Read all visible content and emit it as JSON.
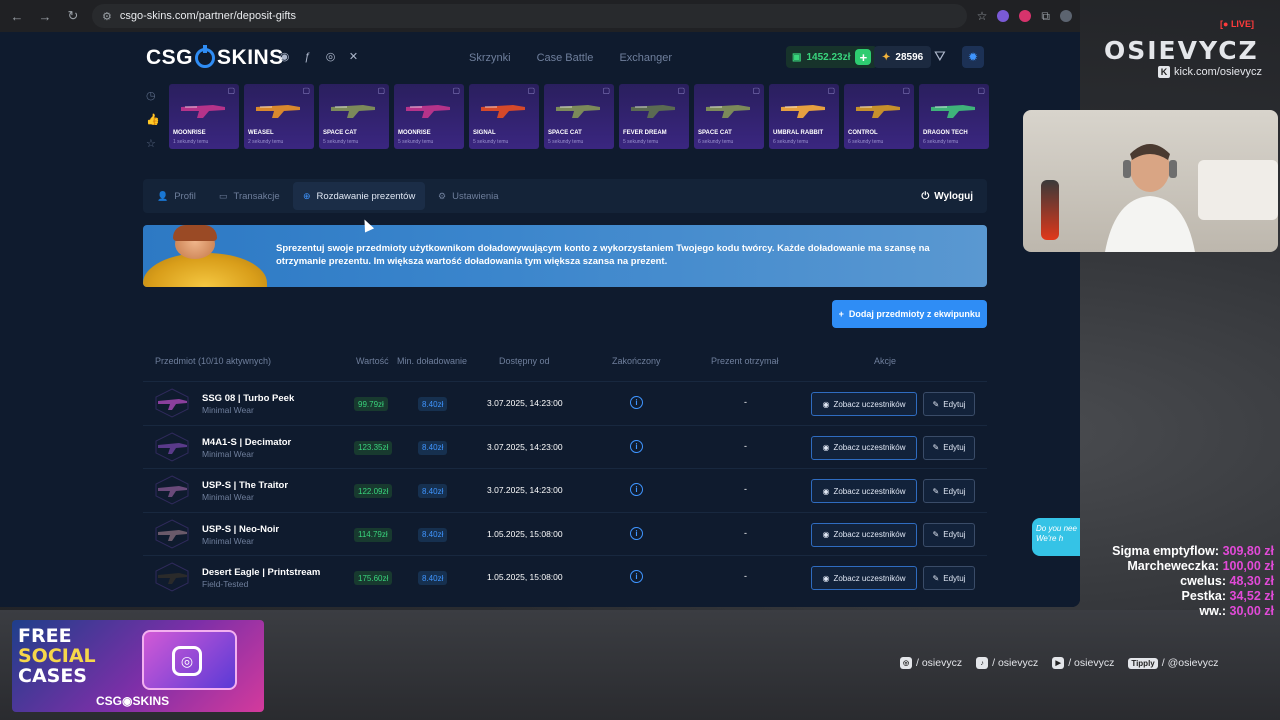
{
  "browser": {
    "url": "csgo-skins.com/partner/deposit-gifts"
  },
  "header": {
    "logo_left": "CSG",
    "logo_right": "SKINS",
    "nav": [
      "Skrzynki",
      "Case Battle",
      "Exchanger"
    ],
    "balance": "1452.23zł",
    "coins": "28596"
  },
  "drops": [
    {
      "name": "MOONRISE",
      "time": "1 sekundy temu",
      "color": "#b5338a"
    },
    {
      "name": "WEASEL",
      "time": "2 sekundy temu",
      "color": "#d9882d"
    },
    {
      "name": "SPACE CAT",
      "time": "5 sekundy temu",
      "color": "#7c8a5a"
    },
    {
      "name": "MOONRISE",
      "time": "5 sekundy temu",
      "color": "#b5338a"
    },
    {
      "name": "SIGNAL",
      "time": "5 sekundy temu",
      "color": "#d6492a"
    },
    {
      "name": "SPACE CAT",
      "time": "5 sekundy temu",
      "color": "#7c8a5a"
    },
    {
      "name": "FEVER DREAM",
      "time": "5 sekundy temu",
      "color": "#5b6a52"
    },
    {
      "name": "SPACE CAT",
      "time": "6 sekundy temu",
      "color": "#7c8a5a"
    },
    {
      "name": "UMBRAL RABBIT",
      "time": "6 sekundy temu",
      "color": "#e6a040"
    },
    {
      "name": "CONTROL",
      "time": "6 sekundy temu",
      "color": "#c6902c"
    },
    {
      "name": "DRAGON TECH",
      "time": "6 sekundy temu",
      "color": "#3fb37a"
    }
  ],
  "tabs": {
    "profile": "Profil",
    "transactions": "Transakcje",
    "gifts": "Rozdawanie prezentów",
    "settings": "Ustawienia",
    "logout": "Wyloguj"
  },
  "banner": {
    "text": "Sprezentuj swoje przedmioty użytkownikom doładowywującym konto z wykorzystaniem Twojego kodu twórcy. Każde doładowanie ma szansę na otrzymanie prezentu. Im większa wartość doładowania tym większa szansa na prezent."
  },
  "add_button": "Dodaj przedmioty z ekwipunku",
  "table": {
    "headers": {
      "item": "Przedmiot (10/10 aktywnych)",
      "value": "Wartość",
      "min_deposit": "Min. doładowanie",
      "available_from": "Dostępny od",
      "finished": "Zakończony",
      "gift_received": "Prezent otrzymał",
      "actions": "Akcje"
    },
    "view_label": "Zobacz uczestników",
    "edit_label": "Edytuj",
    "rows": [
      {
        "name": "SSG 08 | Turbo Peek",
        "wear": "Minimal Wear",
        "value": "99.79zł",
        "min": "8.40zł",
        "date": "3.07.2025, 14:23:00",
        "gift": "-"
      },
      {
        "name": "M4A1-S | Decimator",
        "wear": "Minimal Wear",
        "value": "123.35zł",
        "min": "8.40zł",
        "date": "3.07.2025, 14:23:00",
        "gift": "-"
      },
      {
        "name": "USP-S | The Traitor",
        "wear": "Minimal Wear",
        "value": "122.09zł",
        "min": "8.40zł",
        "date": "3.07.2025, 14:23:00",
        "gift": "-"
      },
      {
        "name": "USP-S | Neo-Noir",
        "wear": "Minimal Wear",
        "value": "114.79zł",
        "min": "8.40zł",
        "date": "1.05.2025, 15:08:00",
        "gift": "-"
      },
      {
        "name": "Desert Eagle | Printstream",
        "wear": "Field-Tested",
        "value": "175.60zł",
        "min": "8.40zł",
        "date": "1.05.2025, 15:08:00",
        "gift": "-"
      }
    ]
  },
  "chat_bubble": {
    "line1": "Do you nee",
    "line2": "We're h"
  },
  "stream": {
    "channel": "OSIEVYCZ",
    "live": "LIVE",
    "kick": "kick.com/osievycz",
    "donations": [
      {
        "name": "Sigma emptyflow:",
        "amount": "309,80 zł"
      },
      {
        "name": "Marcheweczka:",
        "amount": "100,00 zł"
      },
      {
        "name": "cwelus:",
        "amount": "48,30 zł"
      },
      {
        "name": "Pestka:",
        "amount": "34,52 zł"
      },
      {
        "name": "ww.:",
        "amount": "30,00 zł"
      }
    ],
    "promo": {
      "line1": "FREE",
      "line2": "SOCIAL",
      "line3": "CASES",
      "logo": "CSG◉SKINS"
    },
    "socials": {
      "instagram": "/ osievycz",
      "tiktok": "/ osievycz",
      "youtube": "/ osievycz",
      "tipply_label": "Tipply",
      "tipply": "/ @osievycz"
    }
  }
}
